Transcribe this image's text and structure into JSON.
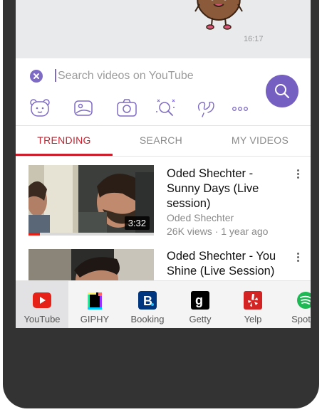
{
  "chat": {
    "timestamp": "16:17"
  },
  "search": {
    "placeholder": "Search videos on YouTube",
    "value": ""
  },
  "colors": {
    "accent": "#7560c2",
    "youtube_red": "#cc1f2d",
    "booking_blue": "#003580",
    "yelp_red": "#d32323",
    "spotify_green": "#1db954"
  },
  "icon_row": [
    "sticker-bear-icon",
    "image-icon",
    "camera-icon",
    "sparkle-search-icon",
    "doodle-icon",
    "more-icon"
  ],
  "tabs": [
    {
      "label": "TRENDING",
      "active": true
    },
    {
      "label": "SEARCH",
      "active": false
    },
    {
      "label": "MY VIDEOS",
      "active": false
    }
  ],
  "videos": [
    {
      "title": "Oded Shechter - Sunny Days (Live session)",
      "channel": "Oded Shechter",
      "meta": "26K views · 1 year ago",
      "duration": "3:32",
      "watched_fraction": 0.09
    },
    {
      "title": "Oded Shechter - You Shine (Live Session)",
      "channel": "",
      "meta": "",
      "duration": "",
      "watched_fraction": 0
    }
  ],
  "apps": [
    {
      "label": "YouTube",
      "icon": "youtube-icon",
      "active": true
    },
    {
      "label": "GIPHY",
      "icon": "giphy-icon",
      "active": false
    },
    {
      "label": "Booking",
      "icon": "booking-icon",
      "active": false
    },
    {
      "label": "Getty",
      "icon": "getty-icon",
      "active": false
    },
    {
      "label": "Yelp",
      "icon": "yelp-icon",
      "active": false
    },
    {
      "label": "Spotify",
      "icon": "spotify-icon",
      "active": false
    }
  ]
}
